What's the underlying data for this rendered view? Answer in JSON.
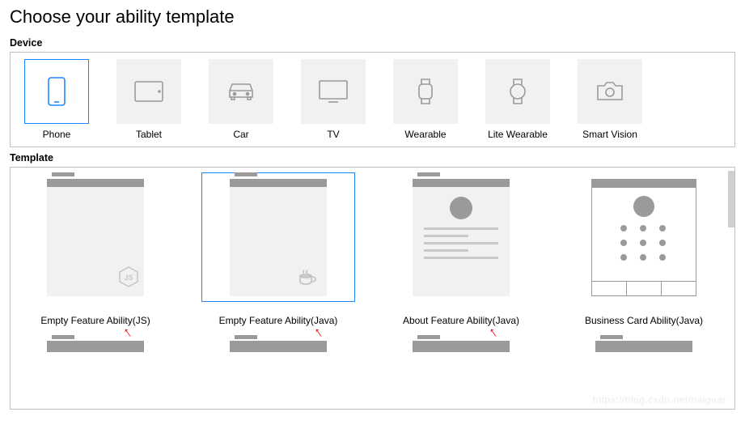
{
  "title": "Choose your ability template",
  "sections": {
    "device": "Device",
    "template": "Template"
  },
  "devices": [
    {
      "id": "phone",
      "label": "Phone",
      "selected": true
    },
    {
      "id": "tablet",
      "label": "Tablet",
      "selected": false
    },
    {
      "id": "car",
      "label": "Car",
      "selected": false
    },
    {
      "id": "tv",
      "label": "TV",
      "selected": false
    },
    {
      "id": "wearable",
      "label": "Wearable",
      "selected": false
    },
    {
      "id": "lite-wearable",
      "label": "Lite Wearable",
      "selected": false
    },
    {
      "id": "smart-vision",
      "label": "Smart Vision",
      "selected": false
    }
  ],
  "templates": [
    {
      "id": "empty-js",
      "label": "Empty Feature Ability(JS)",
      "selected": false,
      "badge": "JS",
      "annotated": true
    },
    {
      "id": "empty-java",
      "label": "Empty Feature Ability(Java)",
      "selected": true,
      "badge": "java",
      "annotated": true
    },
    {
      "id": "about-java",
      "label": "About Feature Ability(Java)",
      "selected": false,
      "badge": "about",
      "annotated": true
    },
    {
      "id": "business-java",
      "label": "Business Card Ability(Java)",
      "selected": false,
      "badge": "biz",
      "annotated": false
    }
  ],
  "watermark": "https://blog.csdn.net/haigear"
}
